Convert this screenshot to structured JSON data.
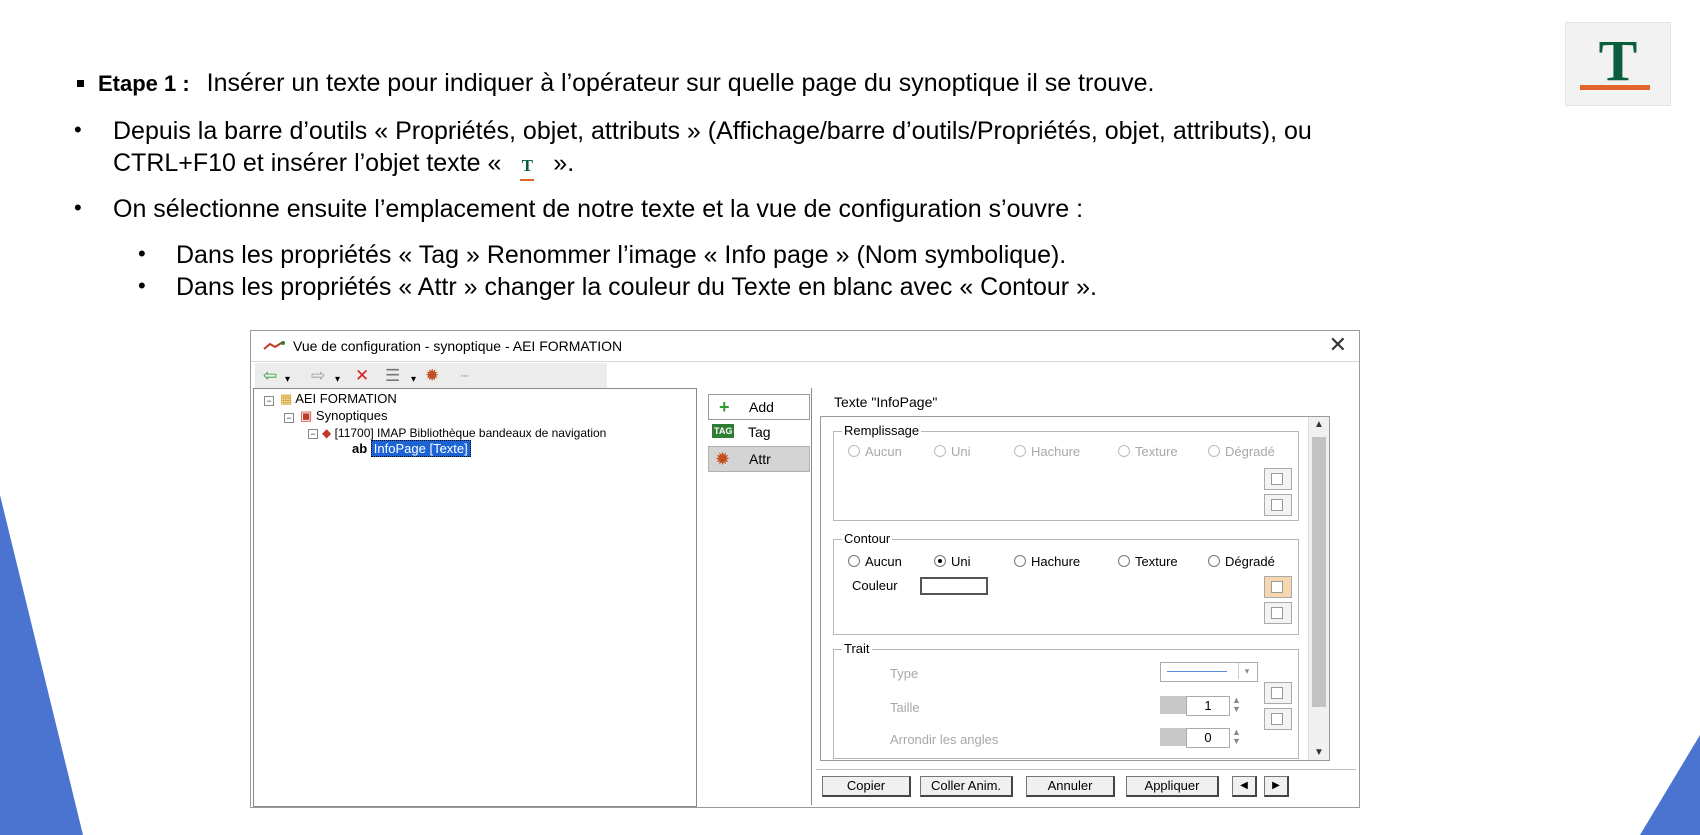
{
  "slide": {
    "step_label": "Etape 1 :",
    "step_text": "Insérer un texte pour indiquer à l’opérateur sur quelle page du synoptique il se trouve.",
    "bullet1_line1": "Depuis la barre d’outils « Propriétés, objet, attributs » (Affichage/barre d’outils/Propriétés, objet, attributs), ou",
    "bullet1_line2_pre": "CTRL+F10 et insérer l’objet texte «",
    "bullet1_line2_post": "».",
    "bullet2": "On sélectionne ensuite l’emplacement de notre texte et la vue de configuration s’ouvre :",
    "sub1": "Dans les propriétés « Tag » Renommer l’image « Info page » (Nom symbolique).",
    "sub2": "Dans les propriétés « Attr » changer la couleur du Texte en blanc avec « Contour ».",
    "logo_letter": "T",
    "inline_icon_letter": "T",
    "accent_green": "#0b5e3d",
    "accent_orange": "#e2652b",
    "corner_blue": "#4a74d0"
  },
  "dialog": {
    "title": "Vue de configuration - synoptique - AEI FORMATION",
    "close_glyph": "✕",
    "tree": {
      "root": "AEI FORMATION",
      "synoptiques": "Synoptiques",
      "page": "[11700]  IMAP Bibliothèque bandeaux de navigation",
      "object_prefix": "ab",
      "object": "InfoPage [Texte]"
    },
    "nav": {
      "add": "Add",
      "tag": "Tag",
      "tag_icon": "TAG",
      "attr": "Attr"
    },
    "props_title": "Texte  \"InfoPage\"",
    "remplissage": {
      "label": "Remplissage",
      "options": [
        "Aucun",
        "Uni",
        "Hachure",
        "Texture",
        "Dégradé"
      ]
    },
    "contour": {
      "label": "Contour",
      "options": [
        "Aucun",
        "Uni",
        "Hachure",
        "Texture",
        "Dégradé"
      ],
      "selected": "Uni",
      "couleur_label": "Couleur",
      "couleur_value": "#ffffff"
    },
    "trait": {
      "label": "Trait",
      "type_label": "Type",
      "taille_label": "Taille",
      "taille_value": "1",
      "arrondir_label": "Arrondir les angles",
      "arrondir_value": "0"
    },
    "buttons": {
      "copier": "Copier",
      "coller": "Coller Anim.",
      "annuler": "Annuler",
      "appliquer": "Appliquer"
    }
  }
}
